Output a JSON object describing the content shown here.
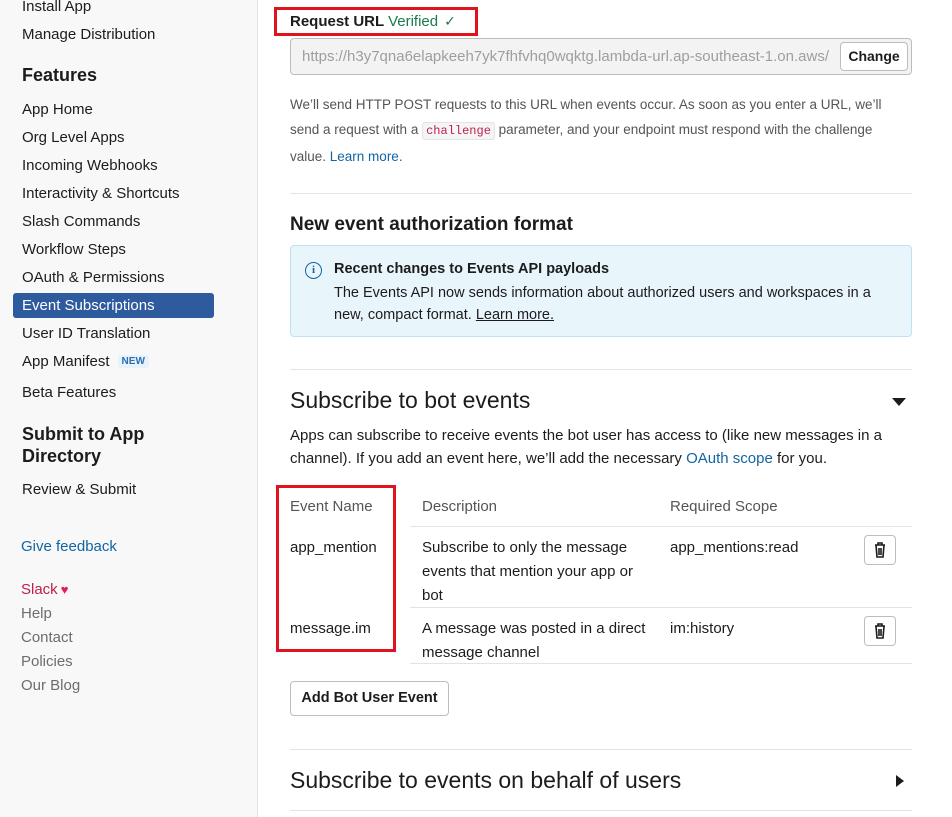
{
  "sidebar": {
    "top_items": [
      "Install App",
      "Manage Distribution"
    ],
    "features_heading": "Features",
    "feature_items": [
      "App Home",
      "Org Level Apps",
      "Incoming Webhooks",
      "Interactivity & Shortcuts",
      "Slash Commands",
      "Workflow Steps",
      "OAuth & Permissions"
    ],
    "active_item": "Event Subscriptions",
    "after_items": [
      "User ID Translation"
    ],
    "manifest_label": "App Manifest",
    "manifest_badge": "NEW",
    "beta_label": "Beta Features",
    "submit_heading": "Submit to App Directory",
    "review_label": "Review & Submit",
    "feedback_label": "Give feedback",
    "slack_label": "Slack",
    "footer_links": [
      "Help",
      "Contact",
      "Policies",
      "Our Blog"
    ]
  },
  "request_url": {
    "label": "Request URL",
    "status": "Verified",
    "url_value": "https://h3y7qna6elapkeeh7yk7fhfvhq0wqktg.lambda-url.ap-southeast-1.on.aws/",
    "change_label": "Change",
    "help_part1": "We’ll send HTTP POST requests to this URL when events occur. As soon as you enter a URL, we’ll send a request with a ",
    "help_code": "challenge",
    "help_part2": " parameter, and your endpoint must respond with the challenge value. ",
    "help_link": "Learn more."
  },
  "auth_format": {
    "title": "New event authorization format",
    "info_title": "Recent changes to Events API payloads",
    "info_body": "The Events API now sends information about authorized users and workspaces in a new, compact format. ",
    "info_link": "Learn more."
  },
  "bot_events": {
    "title": "Subscribe to bot events",
    "desc_part1": "Apps can subscribe to receive events the bot user has access to (like new messages in a channel). If you add an event here, we’ll add the necessary ",
    "desc_link": "OAuth scope",
    "desc_part2": " for you.",
    "columns": [
      "Event Name",
      "Description",
      "Required Scope"
    ],
    "rows": [
      {
        "name": "app_mention",
        "description": "Subscribe to only the message events that mention your app or bot",
        "scope": "app_mentions:read"
      },
      {
        "name": "message.im",
        "description": "A message was posted in a direct message channel",
        "scope": "im:history"
      }
    ],
    "add_button": "Add Bot User Event"
  },
  "user_events": {
    "title": "Subscribe to events on behalf of users"
  },
  "icons": [
    "check-icon",
    "info-icon",
    "trash-icon",
    "caret-down-icon",
    "caret-right-icon",
    "heart-icon"
  ],
  "colors": {
    "accent": "#2e5a9e",
    "link": "#1264a3",
    "verified": "#1a7a4c",
    "highlight": "#e0121d"
  }
}
